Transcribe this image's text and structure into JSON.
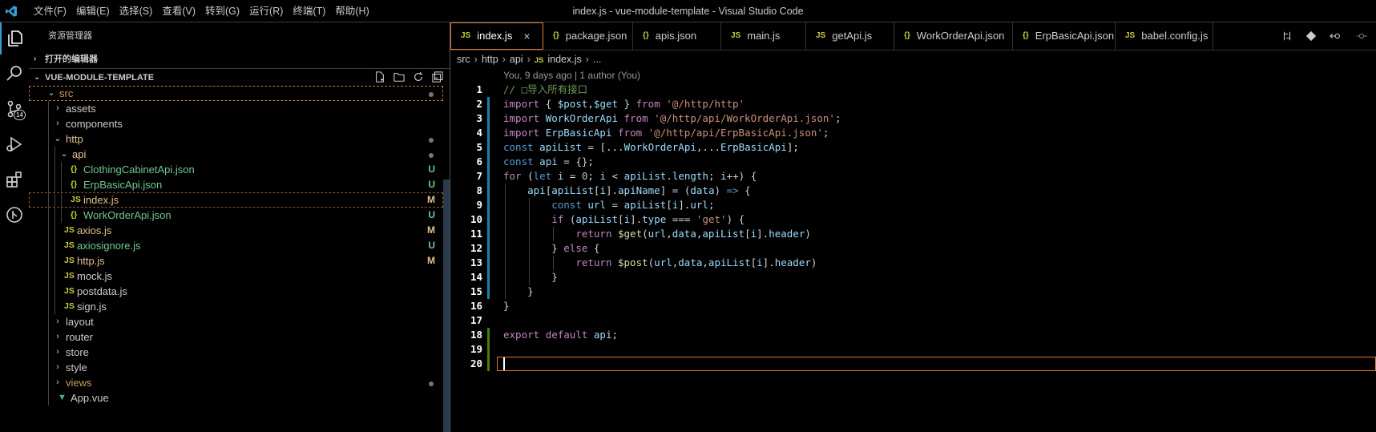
{
  "titlebar": {
    "menu": [
      "文件(F)",
      "编辑(E)",
      "选择(S)",
      "查看(V)",
      "转到(G)",
      "运行(R)",
      "终端(T)",
      "帮助(H)"
    ],
    "window_title": "index.js - vue-module-template - Visual Studio Code"
  },
  "activity": {
    "items": [
      "explorer-icon",
      "search-icon",
      "source-control-icon",
      "run-debug-icon",
      "extensions-icon",
      "git-lens-icon"
    ],
    "scm_badge": "14"
  },
  "sidebar": {
    "title": "资源管理器",
    "open_editors": "打开的编辑器",
    "workspace": "VUE-MODULE-TEMPLATE",
    "tree": [
      {
        "name": "src",
        "kind": "folder",
        "open": true,
        "depth": 0,
        "color": "dim",
        "status": "dot"
      },
      {
        "name": "assets",
        "kind": "folder",
        "open": false,
        "depth": 1,
        "color": "def"
      },
      {
        "name": "components",
        "kind": "folder",
        "open": false,
        "depth": 1,
        "color": "def"
      },
      {
        "name": "http",
        "kind": "folder",
        "open": true,
        "depth": 1,
        "color": "mod",
        "status": "dot"
      },
      {
        "name": "api",
        "kind": "folder",
        "open": true,
        "depth": 2,
        "color": "mod",
        "status": "dot"
      },
      {
        "name": "ClothingCabinetApi.json",
        "kind": "json",
        "depth": 3,
        "color": "green",
        "status": "U"
      },
      {
        "name": "ErpBasicApi.json",
        "kind": "json",
        "depth": 3,
        "color": "green",
        "status": "U"
      },
      {
        "name": "index.js",
        "kind": "js",
        "depth": 3,
        "color": "mod",
        "status": "M",
        "selected": true
      },
      {
        "name": "WorkOrderApi.json",
        "kind": "json",
        "depth": 3,
        "color": "green",
        "status": "U"
      },
      {
        "name": "axios.js",
        "kind": "js",
        "depth": 2,
        "color": "mod",
        "status": "M"
      },
      {
        "name": "axiosignore.js",
        "kind": "js",
        "depth": 2,
        "color": "green",
        "status": "U"
      },
      {
        "name": "http.js",
        "kind": "js",
        "depth": 2,
        "color": "mod",
        "status": "M"
      },
      {
        "name": "mock.js",
        "kind": "js",
        "depth": 2,
        "color": "def"
      },
      {
        "name": "postdata.js",
        "kind": "js",
        "depth": 2,
        "color": "def"
      },
      {
        "name": "sign.js",
        "kind": "js",
        "depth": 2,
        "color": "def"
      },
      {
        "name": "layout",
        "kind": "folder",
        "open": false,
        "depth": 1,
        "color": "def"
      },
      {
        "name": "router",
        "kind": "folder",
        "open": false,
        "depth": 1,
        "color": "def"
      },
      {
        "name": "store",
        "kind": "folder",
        "open": false,
        "depth": 1,
        "color": "def"
      },
      {
        "name": "style",
        "kind": "folder",
        "open": false,
        "depth": 1,
        "color": "def"
      },
      {
        "name": "views",
        "kind": "folder",
        "open": false,
        "depth": 1,
        "color": "dim",
        "status": "dot"
      },
      {
        "name": "App.vue",
        "kind": "vue",
        "depth": 1,
        "color": "def"
      }
    ]
  },
  "editor": {
    "tabs": [
      {
        "label": "index.js",
        "icon": "JS",
        "active": true
      },
      {
        "label": "package.json",
        "icon": "{}"
      },
      {
        "label": "apis.json",
        "icon": "{}"
      },
      {
        "label": "main.js",
        "icon": "JS"
      },
      {
        "label": "getApi.js",
        "icon": "JS"
      },
      {
        "label": "WorkOrderApi.json",
        "icon": "{}"
      },
      {
        "label": "ErpBasicApi.json",
        "icon": "{}"
      },
      {
        "label": "babel.config.js",
        "icon": "JS"
      }
    ],
    "breadcrumb": [
      "src",
      "http",
      "api",
      "index.js",
      "..."
    ],
    "blame": "You, 9 days ago | 1 author (You)",
    "lines": [
      {
        "n": "1",
        "text": "// □导入所有接口"
      },
      {
        "n": "2",
        "text": "import { $post,$get } from '@/http/http'"
      },
      {
        "n": "3",
        "text": "import WorkOrderApi from '@/http/api/WorkOrderApi.json';"
      },
      {
        "n": "4",
        "text": "import ErpBasicApi from '@/http/api/ErpBasicApi.json';"
      },
      {
        "n": "5",
        "text": "const apiList = [...WorkOrderApi,...ErpBasicApi];"
      },
      {
        "n": "6",
        "text": "const api = {};"
      },
      {
        "n": "7",
        "text": "for (let i = 0; i < apiList.length; i++) {"
      },
      {
        "n": "8",
        "text": "    api[apiList[i].apiName] = (data) => {"
      },
      {
        "n": "9",
        "text": "        const url = apiList[i].url;"
      },
      {
        "n": "10",
        "text": "        if (apiList[i].type === 'get') {"
      },
      {
        "n": "11",
        "text": "            return $get(url,data,apiList[i].header)"
      },
      {
        "n": "12",
        "text": "        } else {"
      },
      {
        "n": "13",
        "text": "            return $post(url,data,apiList[i].header)"
      },
      {
        "n": "14",
        "text": "        }"
      },
      {
        "n": "15",
        "text": "    }"
      },
      {
        "n": "16",
        "text": "}"
      },
      {
        "n": "17",
        "text": ""
      },
      {
        "n": "18",
        "text": "export default api;"
      },
      {
        "n": "19",
        "text": ""
      },
      {
        "n": "20",
        "text": ""
      }
    ]
  }
}
